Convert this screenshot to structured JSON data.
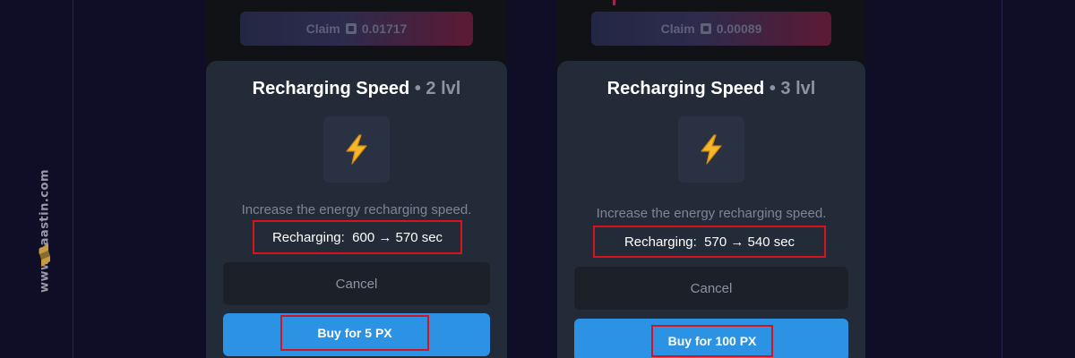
{
  "watermark": {
    "text": "www.Raastin.com",
    "logo_icon": "raastin-logo-icon"
  },
  "colors": {
    "accent_blue": "#2b92e4",
    "highlight_red": "#d8131b",
    "background": "#100d26"
  },
  "panels": [
    {
      "claim": {
        "label": "Claim",
        "amount": "0.01717",
        "icon": "coin-icon"
      },
      "sheet": {
        "title": "Recharging Speed",
        "level": " • 2 lvl",
        "icon": "lightning-bolt-icon",
        "description": "Increase the energy recharging speed.",
        "recharging": "Recharging:  600 → 570 sec",
        "cancel_label": "Cancel",
        "buy_label": "Buy for 5 PX"
      }
    },
    {
      "claim": {
        "label": "Claim",
        "amount": "0.00089",
        "icon": "coin-icon"
      },
      "sheet": {
        "title": "Recharging Speed",
        "level": " • 3 lvl",
        "icon": "lightning-bolt-icon",
        "description": "Increase the energy recharging speed.",
        "recharging": "Recharging:  570 → 540 sec",
        "cancel_label": "Cancel",
        "buy_label": "Buy for 100 PX"
      }
    }
  ]
}
